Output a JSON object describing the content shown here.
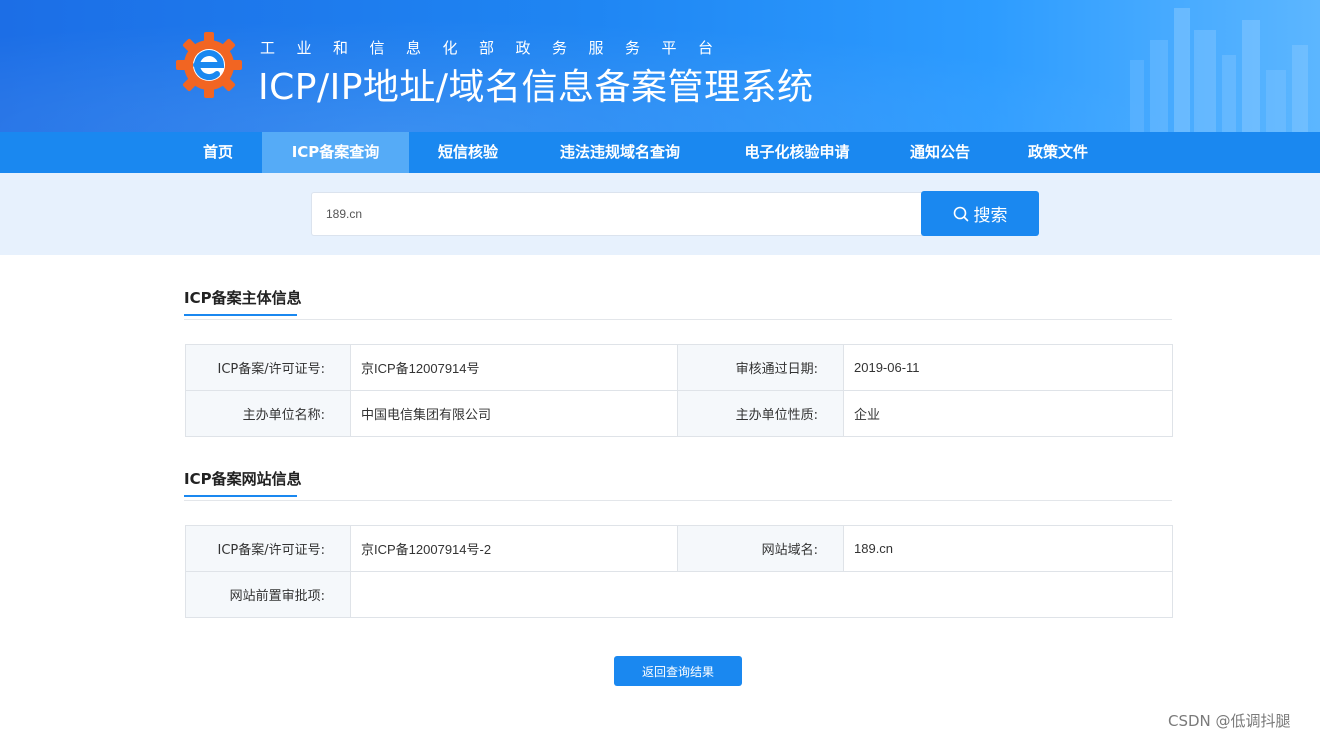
{
  "header": {
    "subtitle": "工业和信息化部政务服务平台",
    "title": "ICP/IP地址/域名信息备案管理系统",
    "logo_icon": "gear-e-logo-icon",
    "colors": {
      "brand_blue": "#1a88f0",
      "logo_orange": "#f26522"
    }
  },
  "nav": {
    "items": [
      {
        "label": "首页",
        "active": false
      },
      {
        "label": "ICP备案查询",
        "active": true
      },
      {
        "label": "短信核验",
        "active": false
      },
      {
        "label": "违法违规域名查询",
        "active": false
      },
      {
        "label": "电子化核验申请",
        "active": false
      },
      {
        "label": "通知公告",
        "active": false
      },
      {
        "label": "政策文件",
        "active": false
      }
    ]
  },
  "search": {
    "value": "189.cn",
    "button_label": "搜索",
    "button_icon": "search-icon"
  },
  "subject_info": {
    "title": "ICP备案主体信息",
    "rows": [
      [
        {
          "label": "ICP备案/许可证号:",
          "value": "京ICP备12007914号"
        },
        {
          "label": "审核通过日期:",
          "value": "2019-06-11"
        }
      ],
      [
        {
          "label": "主办单位名称:",
          "value": "中国电信集团有限公司"
        },
        {
          "label": "主办单位性质:",
          "value": "企业"
        }
      ]
    ]
  },
  "website_info": {
    "title": "ICP备案网站信息",
    "rows": [
      [
        {
          "label": "ICP备案/许可证号:",
          "value": "京ICP备12007914号-2"
        },
        {
          "label": "网站域名:",
          "value": "189.cn"
        }
      ],
      [
        {
          "label": "网站前置审批项:",
          "value": ""
        }
      ]
    ]
  },
  "back_button_label": "返回查询结果",
  "watermark": "CSDN @低调抖腿"
}
